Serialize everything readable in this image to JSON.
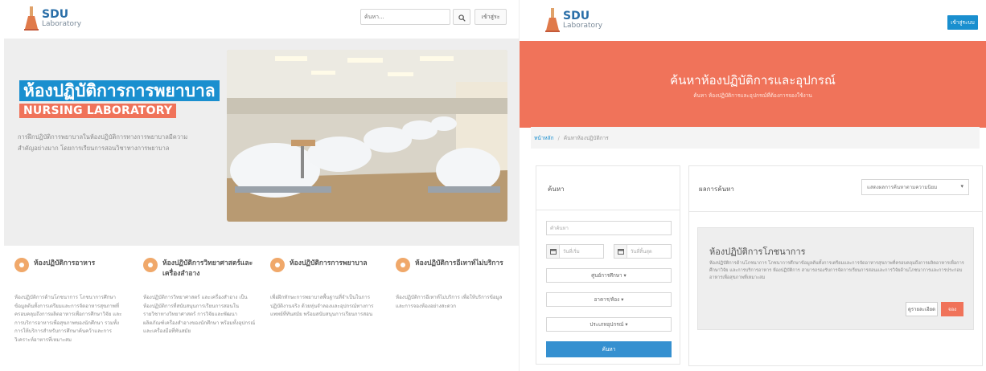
{
  "left": {
    "logo": {
      "line1": "SDU",
      "line2": "Laboratory"
    },
    "search": {
      "placeholder": "ค้นหา..."
    },
    "search_icon": "search-icon",
    "login_label": "เข้าสู่ระ",
    "hero": {
      "title": "ห้องปฏิบัติการการพยาบาล",
      "subtitle": "NURSING LABORATORY",
      "description": "การฝึกปฏิบัติการพยาบาลในห้องปฏิบัติการทางการพยาบาลมีความสำคัญอย่างมาก โดยการเรียนการสอนวิชาทางการพยาบาล"
    },
    "features": [
      {
        "title": "ห้องปฏิบัติการอาหาร",
        "desc": "ห้องปฏิบัติการด้านโภชนาการ โภชนาการศึกษาข้อมูลต้นทั้งการเตรียมและการจัดอาหารสุขภาพที่ครอบคลุมถึงการผลิตอาหารเพื่อการศึกษาวิจัย และการบริการอาหารเพื่อสุขภาพของนักศึกษา รวมทั้งการให้บริการสำหรับการศึกษาค้นคว้าและการวิเคราะห์อาหารที่เหมาะสม"
      },
      {
        "title": "ห้องปฏิบัติการวิทยาศาสตร์และเครื่องสำอาง",
        "desc": "ห้องปฏิบัติการวิทยาศาสตร์ และเครื่องสำอาง เป็นห้องปฏิบัติการที่สนับสนุนการเรียนการสอนในรายวิชาทางวิทยาศาสตร์ การวิจัยและพัฒนาผลิตภัณฑ์เครื่องสำอางของนักศึกษา พร้อมทั้งอุปกรณ์และเครื่องมือที่ทันสมัย"
      },
      {
        "title": "ห้องปฏิบัติการการพยาบาล",
        "desc": "เพื่อฝึกทักษะการพยาบาลพื้นฐานที่จำเป็นในการปฏิบัติงานจริง ด้วยหุ่นจำลองและอุปกรณ์ทางการแพทย์ที่ทันสมัย พร้อมสนับสนุนการเรียนการสอน"
      },
      {
        "title": "ห้องปฏิบัติการอีเทาท์ไม่บริการ",
        "desc": "ห้องปฏิบัติการอีเทาท์ไม่บริการ เพื่อให้บริการข้อมูลและการจองห้องอย่างสะดวก"
      }
    ]
  },
  "right": {
    "logo": {
      "line1": "SDU",
      "line2": "Laboratory"
    },
    "login_label": "เข้าสู่ระบบ",
    "banner": {
      "title": "ค้นหาห้องปฏิบัติการและอุปกรณ์",
      "subtitle": "ค้นหา ห้องปฏิบัติการและอุปกรณ์ที่ต้องการจองใช้งาน"
    },
    "breadcrumb": {
      "home": "หน้าหลัก",
      "separator": "/",
      "current": "ค้นหาห้องปฏิบัติการ"
    },
    "search_panel": {
      "title": "ค้นหา",
      "keyword_placeholder": "คำค้นหา",
      "date_start": "วันที่เริ่ม",
      "date_end": "วันที่สิ้นสุด",
      "drop1": "ศูนย์การศึกษา ▾",
      "drop2": "อาคาร/ห้อง ▾",
      "drop3": "ประเภทอุปกรณ์ ▾",
      "search_label": "ค้นหา"
    },
    "results": {
      "title": "ผลการค้นหา",
      "sort_label": "แสดงผลการค้นหาตามความนิยม",
      "card": {
        "title": "ห้องปฏิบัติการโภชนาการ",
        "desc": "ห้องปฏิบัติการด้านโภชนาการ โภชนาการศึกษาข้อมูลต้นทั้งการเตรียมและการจัดอาหารสุขภาพที่ครอบคลุมถึงการผลิตอาหารเพื่อการศึกษาวิจัย และการบริการอาหาร ห้องปฏิบัติการ สามารถรองรับการจัดการเรียนการสอนและการวิจัยด้านโภชนาการและการประกอบอาหารเพื่อสุขภาพที่เหมาะสม",
        "detail_label": "ดูรายละเอียด",
        "book_label": "จอง"
      }
    }
  },
  "colors": {
    "accent": "#f0735a",
    "primary": "#1a8fcf"
  }
}
